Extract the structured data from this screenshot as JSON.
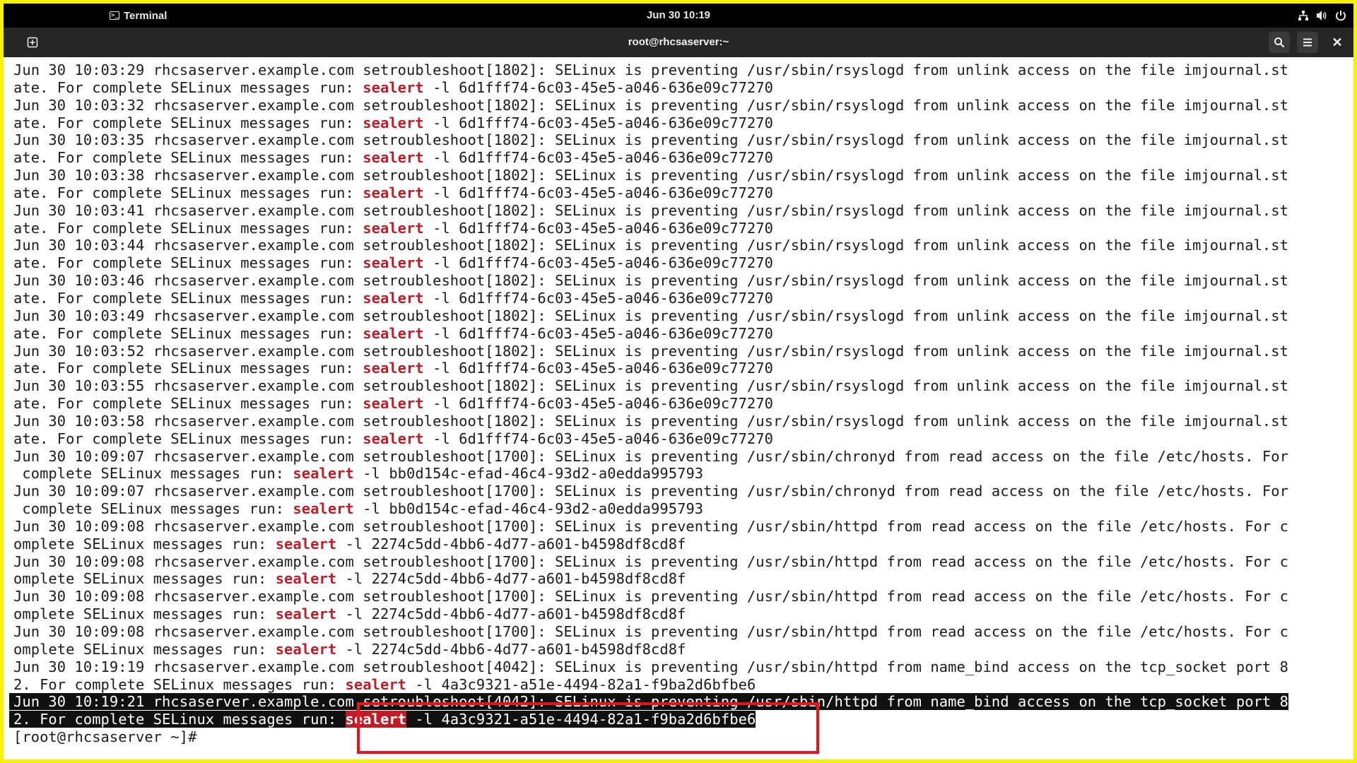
{
  "topbar": {
    "app_name": "Terminal",
    "clock": "Jun 30 10:19",
    "icons": [
      "network-icon",
      "volume-icon",
      "power-icon"
    ]
  },
  "window": {
    "title": "root@rhcsaserver:~",
    "icons": [
      "new-tab-icon",
      "search-icon",
      "hamburger-menu-icon",
      "close-icon"
    ]
  },
  "terminal": {
    "keyword": "sealert",
    "lines": [
      {
        "pre": "Jun 30 10:03:29 rhcsaserver.example.com setroubleshoot[1802]: SELinux is preventing /usr/sbin/rsyslogd from unlink access on the file imjournal.st",
        "kw": "",
        "post": ""
      },
      {
        "pre": "ate. For complete SELinux messages run: ",
        "kw": "sealert",
        "post": " -l 6d1fff74-6c03-45e5-a046-636e09c77270"
      },
      {
        "pre": "Jun 30 10:03:32 rhcsaserver.example.com setroubleshoot[1802]: SELinux is preventing /usr/sbin/rsyslogd from unlink access on the file imjournal.st",
        "kw": "",
        "post": ""
      },
      {
        "pre": "ate. For complete SELinux messages run: ",
        "kw": "sealert",
        "post": " -l 6d1fff74-6c03-45e5-a046-636e09c77270"
      },
      {
        "pre": "Jun 30 10:03:35 rhcsaserver.example.com setroubleshoot[1802]: SELinux is preventing /usr/sbin/rsyslogd from unlink access on the file imjournal.st",
        "kw": "",
        "post": ""
      },
      {
        "pre": "ate. For complete SELinux messages run: ",
        "kw": "sealert",
        "post": " -l 6d1fff74-6c03-45e5-a046-636e09c77270"
      },
      {
        "pre": "Jun 30 10:03:38 rhcsaserver.example.com setroubleshoot[1802]: SELinux is preventing /usr/sbin/rsyslogd from unlink access on the file imjournal.st",
        "kw": "",
        "post": ""
      },
      {
        "pre": "ate. For complete SELinux messages run: ",
        "kw": "sealert",
        "post": " -l 6d1fff74-6c03-45e5-a046-636e09c77270"
      },
      {
        "pre": "Jun 30 10:03:41 rhcsaserver.example.com setroubleshoot[1802]: SELinux is preventing /usr/sbin/rsyslogd from unlink access on the file imjournal.st",
        "kw": "",
        "post": ""
      },
      {
        "pre": "ate. For complete SELinux messages run: ",
        "kw": "sealert",
        "post": " -l 6d1fff74-6c03-45e5-a046-636e09c77270"
      },
      {
        "pre": "Jun 30 10:03:44 rhcsaserver.example.com setroubleshoot[1802]: SELinux is preventing /usr/sbin/rsyslogd from unlink access on the file imjournal.st",
        "kw": "",
        "post": ""
      },
      {
        "pre": "ate. For complete SELinux messages run: ",
        "kw": "sealert",
        "post": " -l 6d1fff74-6c03-45e5-a046-636e09c77270"
      },
      {
        "pre": "Jun 30 10:03:46 rhcsaserver.example.com setroubleshoot[1802]: SELinux is preventing /usr/sbin/rsyslogd from unlink access on the file imjournal.st",
        "kw": "",
        "post": ""
      },
      {
        "pre": "ate. For complete SELinux messages run: ",
        "kw": "sealert",
        "post": " -l 6d1fff74-6c03-45e5-a046-636e09c77270"
      },
      {
        "pre": "Jun 30 10:03:49 rhcsaserver.example.com setroubleshoot[1802]: SELinux is preventing /usr/sbin/rsyslogd from unlink access on the file imjournal.st",
        "kw": "",
        "post": ""
      },
      {
        "pre": "ate. For complete SELinux messages run: ",
        "kw": "sealert",
        "post": " -l 6d1fff74-6c03-45e5-a046-636e09c77270"
      },
      {
        "pre": "Jun 30 10:03:52 rhcsaserver.example.com setroubleshoot[1802]: SELinux is preventing /usr/sbin/rsyslogd from unlink access on the file imjournal.st",
        "kw": "",
        "post": ""
      },
      {
        "pre": "ate. For complete SELinux messages run: ",
        "kw": "sealert",
        "post": " -l 6d1fff74-6c03-45e5-a046-636e09c77270"
      },
      {
        "pre": "Jun 30 10:03:55 rhcsaserver.example.com setroubleshoot[1802]: SELinux is preventing /usr/sbin/rsyslogd from unlink access on the file imjournal.st",
        "kw": "",
        "post": ""
      },
      {
        "pre": "ate. For complete SELinux messages run: ",
        "kw": "sealert",
        "post": " -l 6d1fff74-6c03-45e5-a046-636e09c77270"
      },
      {
        "pre": "Jun 30 10:03:58 rhcsaserver.example.com setroubleshoot[1802]: SELinux is preventing /usr/sbin/rsyslogd from unlink access on the file imjournal.st",
        "kw": "",
        "post": ""
      },
      {
        "pre": "ate. For complete SELinux messages run: ",
        "kw": "sealert",
        "post": " -l 6d1fff74-6c03-45e5-a046-636e09c77270"
      },
      {
        "pre": "Jun 30 10:09:07 rhcsaserver.example.com setroubleshoot[1700]: SELinux is preventing /usr/sbin/chronyd from read access on the file /etc/hosts. For",
        "kw": "",
        "post": ""
      },
      {
        "pre": " complete SELinux messages run: ",
        "kw": "sealert",
        "post": " -l bb0d154c-efad-46c4-93d2-a0edda995793"
      },
      {
        "pre": "Jun 30 10:09:07 rhcsaserver.example.com setroubleshoot[1700]: SELinux is preventing /usr/sbin/chronyd from read access on the file /etc/hosts. For",
        "kw": "",
        "post": ""
      },
      {
        "pre": " complete SELinux messages run: ",
        "kw": "sealert",
        "post": " -l bb0d154c-efad-46c4-93d2-a0edda995793"
      },
      {
        "pre": "Jun 30 10:09:08 rhcsaserver.example.com setroubleshoot[1700]: SELinux is preventing /usr/sbin/httpd from read access on the file /etc/hosts. For c",
        "kw": "",
        "post": ""
      },
      {
        "pre": "omplete SELinux messages run: ",
        "kw": "sealert",
        "post": " -l 2274c5dd-4bb6-4d77-a601-b4598df8cd8f"
      },
      {
        "pre": "Jun 30 10:09:08 rhcsaserver.example.com setroubleshoot[1700]: SELinux is preventing /usr/sbin/httpd from read access on the file /etc/hosts. For c",
        "kw": "",
        "post": ""
      },
      {
        "pre": "omplete SELinux messages run: ",
        "kw": "sealert",
        "post": " -l 2274c5dd-4bb6-4d77-a601-b4598df8cd8f"
      },
      {
        "pre": "Jun 30 10:09:08 rhcsaserver.example.com setroubleshoot[1700]: SELinux is preventing /usr/sbin/httpd from read access on the file /etc/hosts. For c",
        "kw": "",
        "post": ""
      },
      {
        "pre": "omplete SELinux messages run: ",
        "kw": "sealert",
        "post": " -l 2274c5dd-4bb6-4d77-a601-b4598df8cd8f"
      },
      {
        "pre": "Jun 30 10:09:08 rhcsaserver.example.com setroubleshoot[1700]: SELinux is preventing /usr/sbin/httpd from read access on the file /etc/hosts. For c",
        "kw": "",
        "post": ""
      },
      {
        "pre": "omplete SELinux messages run: ",
        "kw": "sealert",
        "post": " -l 2274c5dd-4bb6-4d77-a601-b4598df8cd8f"
      },
      {
        "pre": "Jun 30 10:19:19 rhcsaserver.example.com setroubleshoot[4042]: SELinux is preventing /usr/sbin/httpd from name_bind access on the tcp_socket port 8",
        "kw": "",
        "post": ""
      },
      {
        "pre": "2. For complete SELinux messages run: ",
        "kw": "sealert",
        "post": " -l 4a3c9321-a51e-4494-82a1-f9ba2d6bfbe6"
      },
      {
        "pre": "Jun 30 10:19:21 rhcsaserver.example.com setroubleshoot[4042]: SELinux is preventing /usr/sbin/httpd from name_bind access on the tcp_socket port 8",
        "kw": "",
        "post": "",
        "selected": true
      },
      {
        "pre": "2. For complete SELinux messages run: ",
        "kw": "sealert",
        "post": " -l 4a3c9321-a51e-4494-82a1-f9ba2d6bfbe6",
        "selected": true
      }
    ],
    "prompt": "[root@rhcsaserver ~]#"
  },
  "colors": {
    "frame_border": "#f7f100",
    "keyword": "#c01c28",
    "annotation_box": "#e8141c",
    "selection_bg": "#111111"
  }
}
